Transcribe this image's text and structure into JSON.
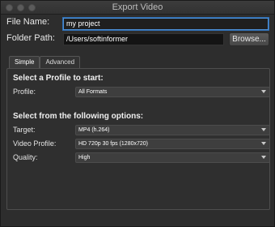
{
  "window": {
    "title": "Export Video"
  },
  "file": {
    "name_label": "File Name:",
    "name_value": "my project",
    "path_label": "Folder Path:",
    "path_value": "/Users/softinformer",
    "browse_label": "Browse..."
  },
  "tabs": [
    {
      "label": "Simple",
      "active": true
    },
    {
      "label": "Advanced",
      "active": false
    }
  ],
  "profile_section": {
    "heading": "Select a Profile to start:",
    "profile_label": "Profile:",
    "profile_value": "All Formats"
  },
  "options_section": {
    "heading": "Select from the following options:",
    "target_label": "Target:",
    "target_value": "MP4 (h.264)",
    "video_profile_label": "Video Profile:",
    "video_profile_value": "HD 720p 30 fps (1280x720)",
    "quality_label": "Quality:",
    "quality_value": "High"
  },
  "colors": {
    "background": "#2d2d2d",
    "focus_accent": "#4d8fd6"
  },
  "icons": [
    "dropdown-caret-icon"
  ]
}
